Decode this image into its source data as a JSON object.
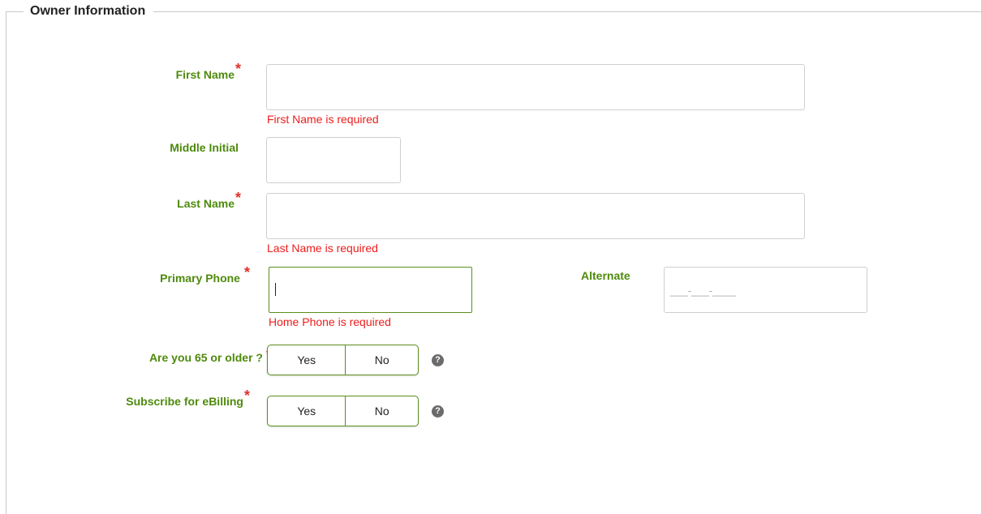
{
  "section": {
    "legend": "Owner Information"
  },
  "fields": {
    "first_name": {
      "label": "First Name",
      "required_mark": "*",
      "value": "",
      "error": "First Name is required"
    },
    "middle_initial": {
      "label": "Middle Initial",
      "value": ""
    },
    "last_name": {
      "label": "Last Name",
      "required_mark": "*",
      "value": "",
      "error": "Last Name is required"
    },
    "primary_phone": {
      "label": "Primary Phone",
      "required_mark": "*",
      "value": "",
      "focused": true,
      "error": "Home Phone is required"
    },
    "alternate_phone": {
      "label": "Alternate",
      "mask": "___-___-____"
    },
    "age_65": {
      "label": "Are you 65 or older ?",
      "required_mark": "*",
      "options": [
        "Yes",
        "No"
      ],
      "help_icon": "question-circle-icon"
    },
    "ebilling": {
      "label": "Subscribe for eBilling",
      "required_mark": "*",
      "options": [
        "Yes",
        "No"
      ],
      "help_icon": "question-circle-icon"
    }
  },
  "colors": {
    "label_green": "#4e8a0c",
    "required_red": "#e0302a",
    "error_red": "#ee1c1c",
    "focus_green": "#5a8f1c"
  }
}
